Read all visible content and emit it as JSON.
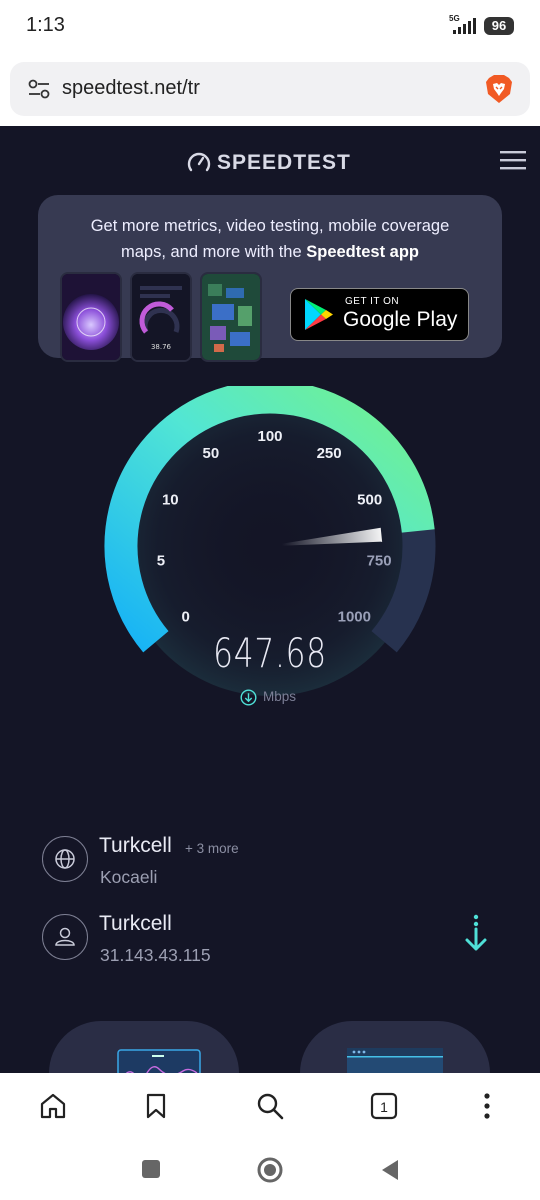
{
  "status": {
    "time": "1:13",
    "network": "5G",
    "battery": "96"
  },
  "browser": {
    "url": "speedtest.net/tr"
  },
  "header": {
    "brand": "SPEEDTEST"
  },
  "promo": {
    "line1": "Get more metrics, video testing, mobile coverage",
    "line2_prefix": "maps, and more with the ",
    "line2_bold": "Speedtest app",
    "store_small": "GET IT ON",
    "store_big": "Google Play",
    "phone_reading": "38.76"
  },
  "gauge": {
    "scale_labels": [
      "0",
      "5",
      "10",
      "50",
      "100",
      "250",
      "500",
      "750",
      "1000"
    ],
    "value": 647.68,
    "value_text": "647.68",
    "unit": "Mbps",
    "max": 1000
  },
  "server": {
    "name": "Turkcell",
    "more": "+ 3 more",
    "location": "Kocaeli"
  },
  "client": {
    "name": "Turkcell",
    "ip": "31.143.43.115"
  },
  "colors": {
    "bg": "#141526",
    "gauge_start": "#1ab6f5",
    "gauge_end": "#6cf08c",
    "accent": "#4fe0d7"
  }
}
